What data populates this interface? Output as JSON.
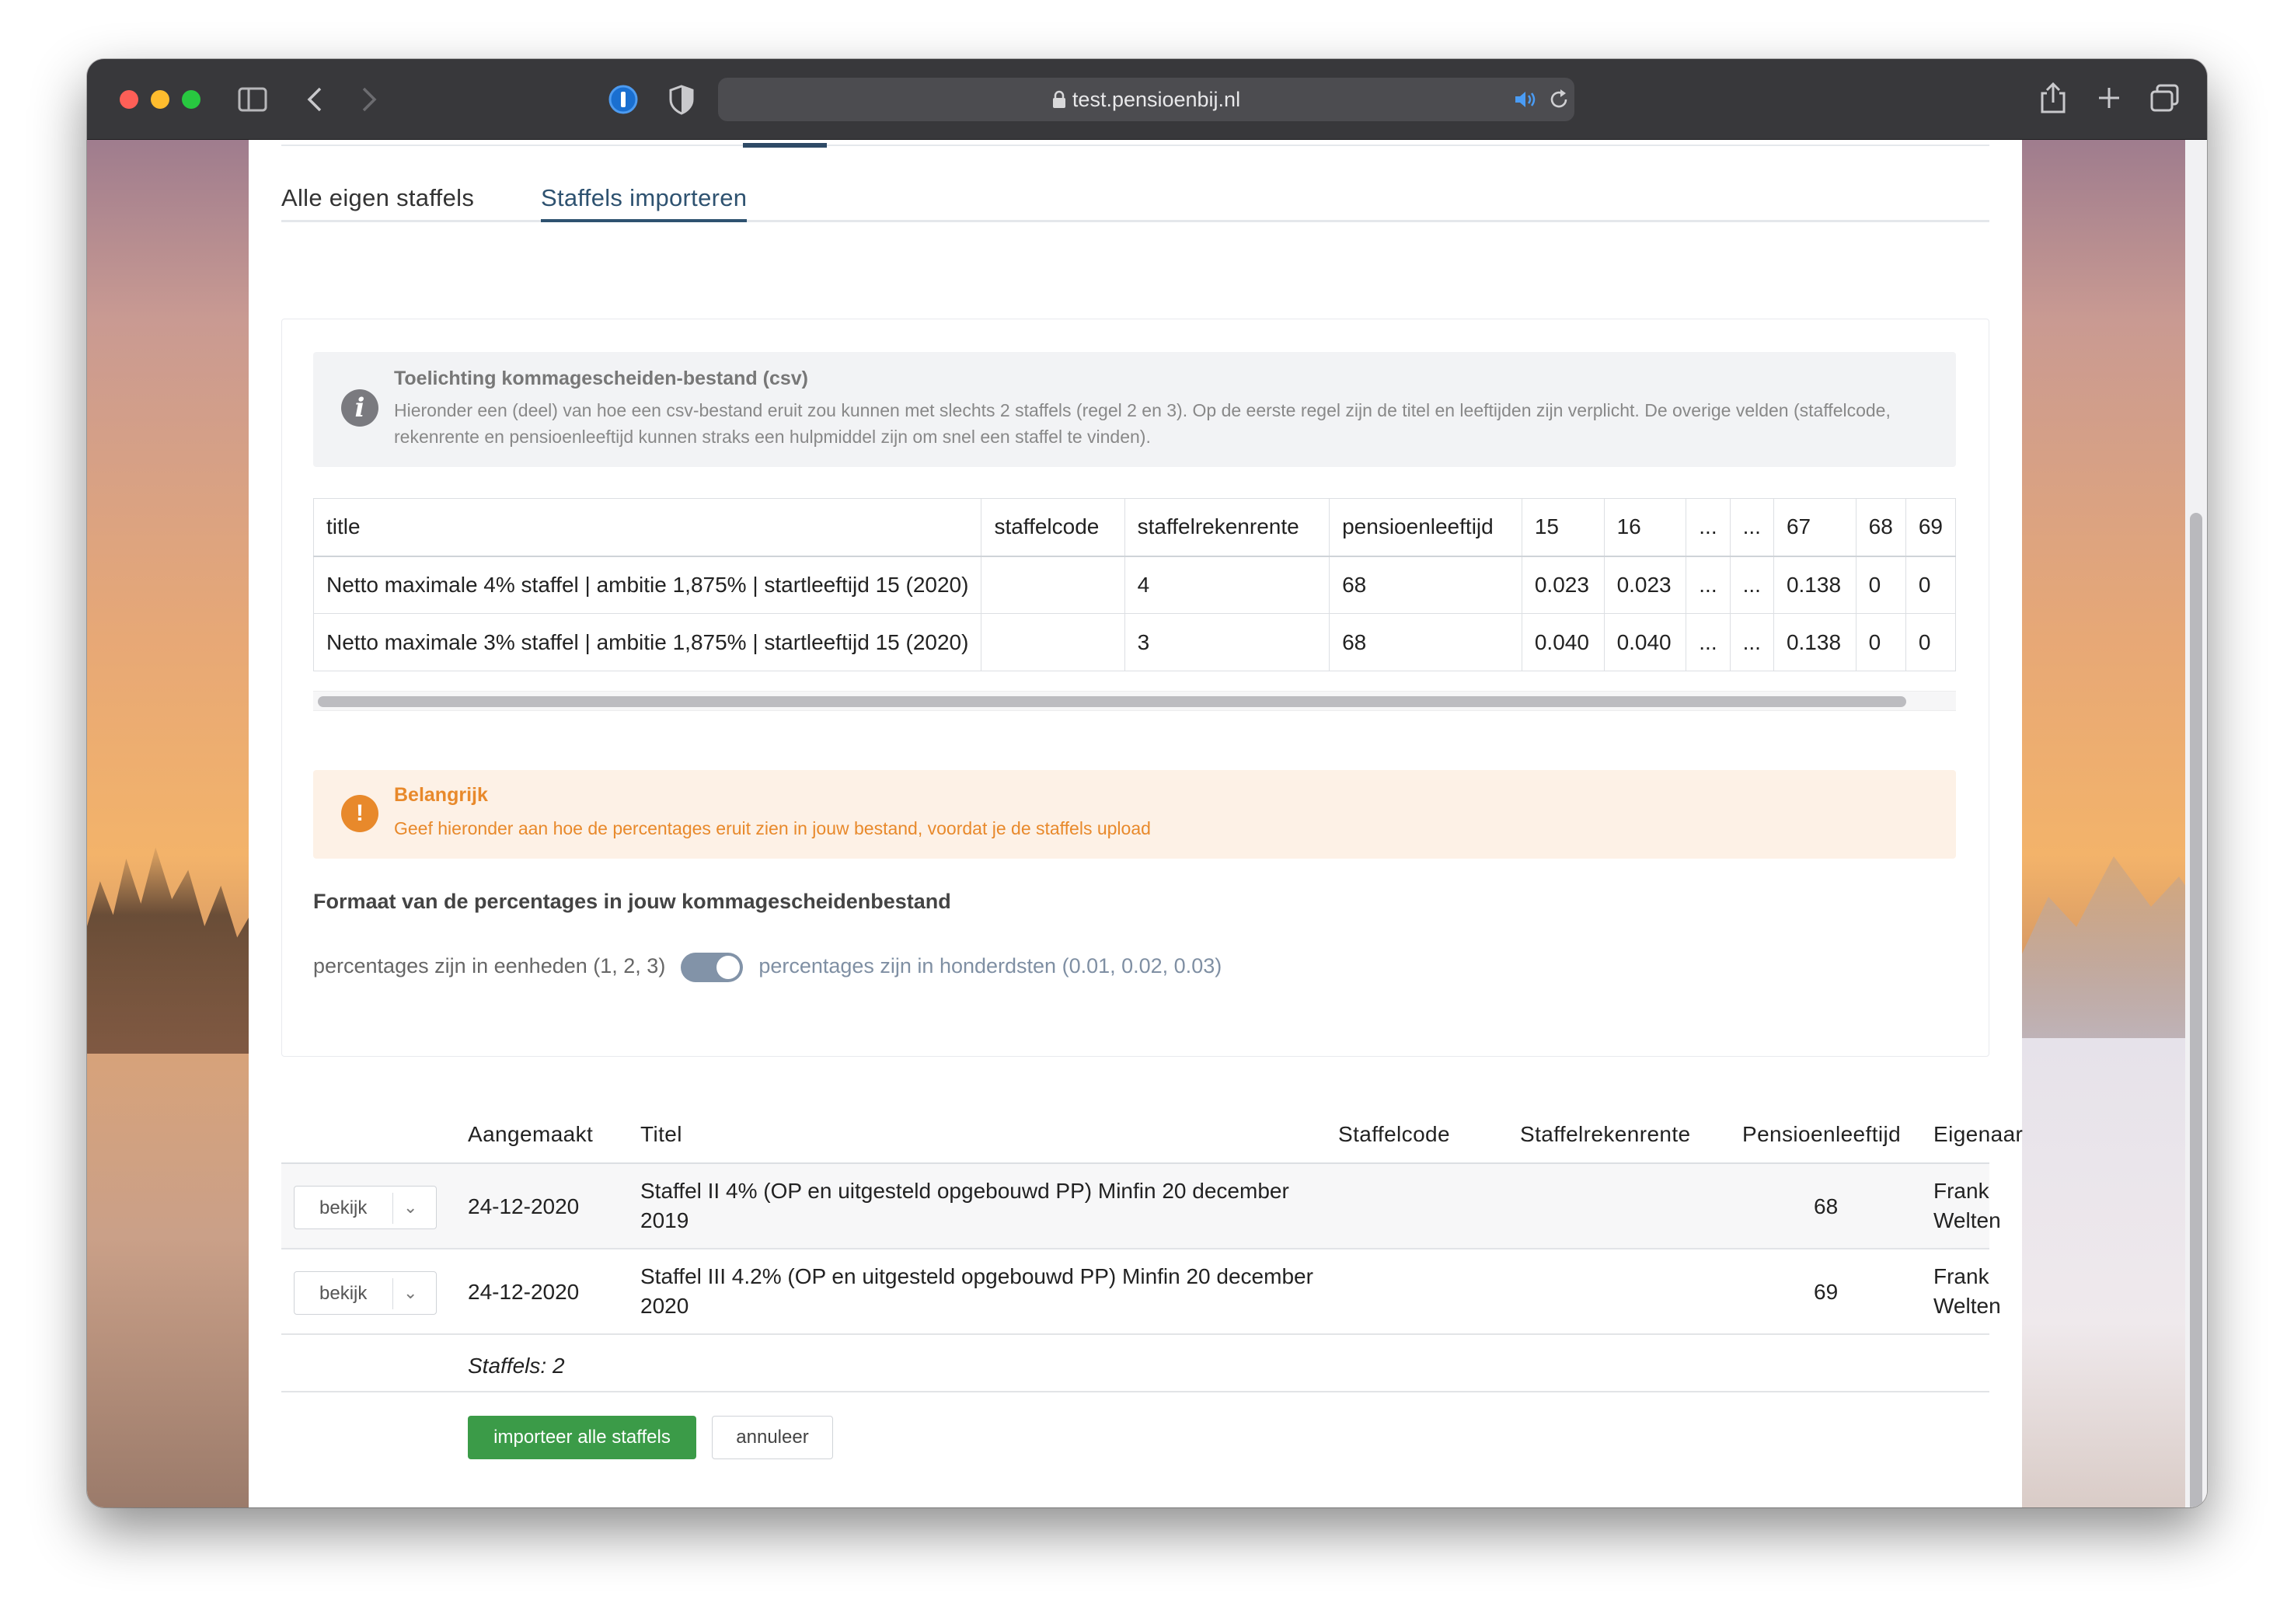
{
  "browser": {
    "url": "test.pensioenbij.nl"
  },
  "tabs": [
    {
      "label": "Alle eigen staffels",
      "active": false
    },
    {
      "label": "Staffels importeren",
      "active": true
    }
  ],
  "info_alert": {
    "title": "Toelichting kommagescheiden-bestand (csv)",
    "text": "Hieronder een (deel) van hoe een csv-bestand eruit zou kunnen met slechts 2 staffels (regel 2 en 3). Op de eerste regel zijn de titel en leeftijden zijn verplicht. De overige velden (staffelcode, rekenrente en pensioenleeftijd kunnen straks een hulpmiddel zijn om snel een staffel te vinden)."
  },
  "csv_example": {
    "headers": [
      "title",
      "staffelcode",
      "staffelrekenrente",
      "pensioenleeftijd",
      "15",
      "16",
      "...",
      "...",
      "67",
      "68",
      "69"
    ],
    "rows": [
      [
        "Netto maximale 4% staffel | ambitie 1,875% | startleeftijd 15 (2020)",
        "",
        "4",
        "68",
        "0.023",
        "0.023",
        "...",
        "...",
        "0.138",
        "0",
        "0"
      ],
      [
        "Netto maximale 3% staffel | ambitie 1,875% | startleeftijd 15 (2020)",
        "",
        "3",
        "68",
        "0.040",
        "0.040",
        "...",
        "...",
        "0.138",
        "0",
        "0"
      ]
    ]
  },
  "warning_alert": {
    "title": "Belangrijk",
    "text": "Geef hieronder aan hoe de percentages eruit zien in jouw bestand, voordat je de staffels upload"
  },
  "format": {
    "title": "Formaat van de percentages in jouw kommagescheidenbestand",
    "option_left": "percentages zijn in eenheden (1, 2, 3)",
    "option_right": "percentages zijn in honderdsten (0.01, 0.02, 0.03)",
    "toggle_on": true
  },
  "import_table": {
    "headers": {
      "created": "Aangemaakt",
      "title": "Titel",
      "code": "Staffelcode",
      "rate": "Staffelrekenrente",
      "age": "Pensioenleeftijd",
      "owner": "Eigenaar"
    },
    "rows": [
      {
        "action": "bekijk",
        "created": "24-12-2020",
        "title_line1": "Staffel II 4% (OP en uitgesteld opgebouwd PP) Minfin 20 december",
        "title_line2": "2019",
        "code": "",
        "rate": "",
        "age": "68",
        "owner_line1": "Frank",
        "owner_line2": "Welten"
      },
      {
        "action": "bekijk",
        "created": "24-12-2020",
        "title_line1": "Staffel III 4.2% (OP en uitgesteld opgebouwd PP) Minfin 20 december",
        "title_line2": "2020",
        "code": "",
        "rate": "",
        "age": "69",
        "owner_line1": "Frank",
        "owner_line2": "Welten"
      }
    ],
    "count": "Staffels: 2"
  },
  "actions": {
    "import_all": "importeer alle staffels",
    "cancel": "annuleer"
  },
  "colors": {
    "accent": "#2e5270",
    "success": "#3b9b48",
    "warning": "#e8892b",
    "info_icon": "#7a7a7f"
  }
}
